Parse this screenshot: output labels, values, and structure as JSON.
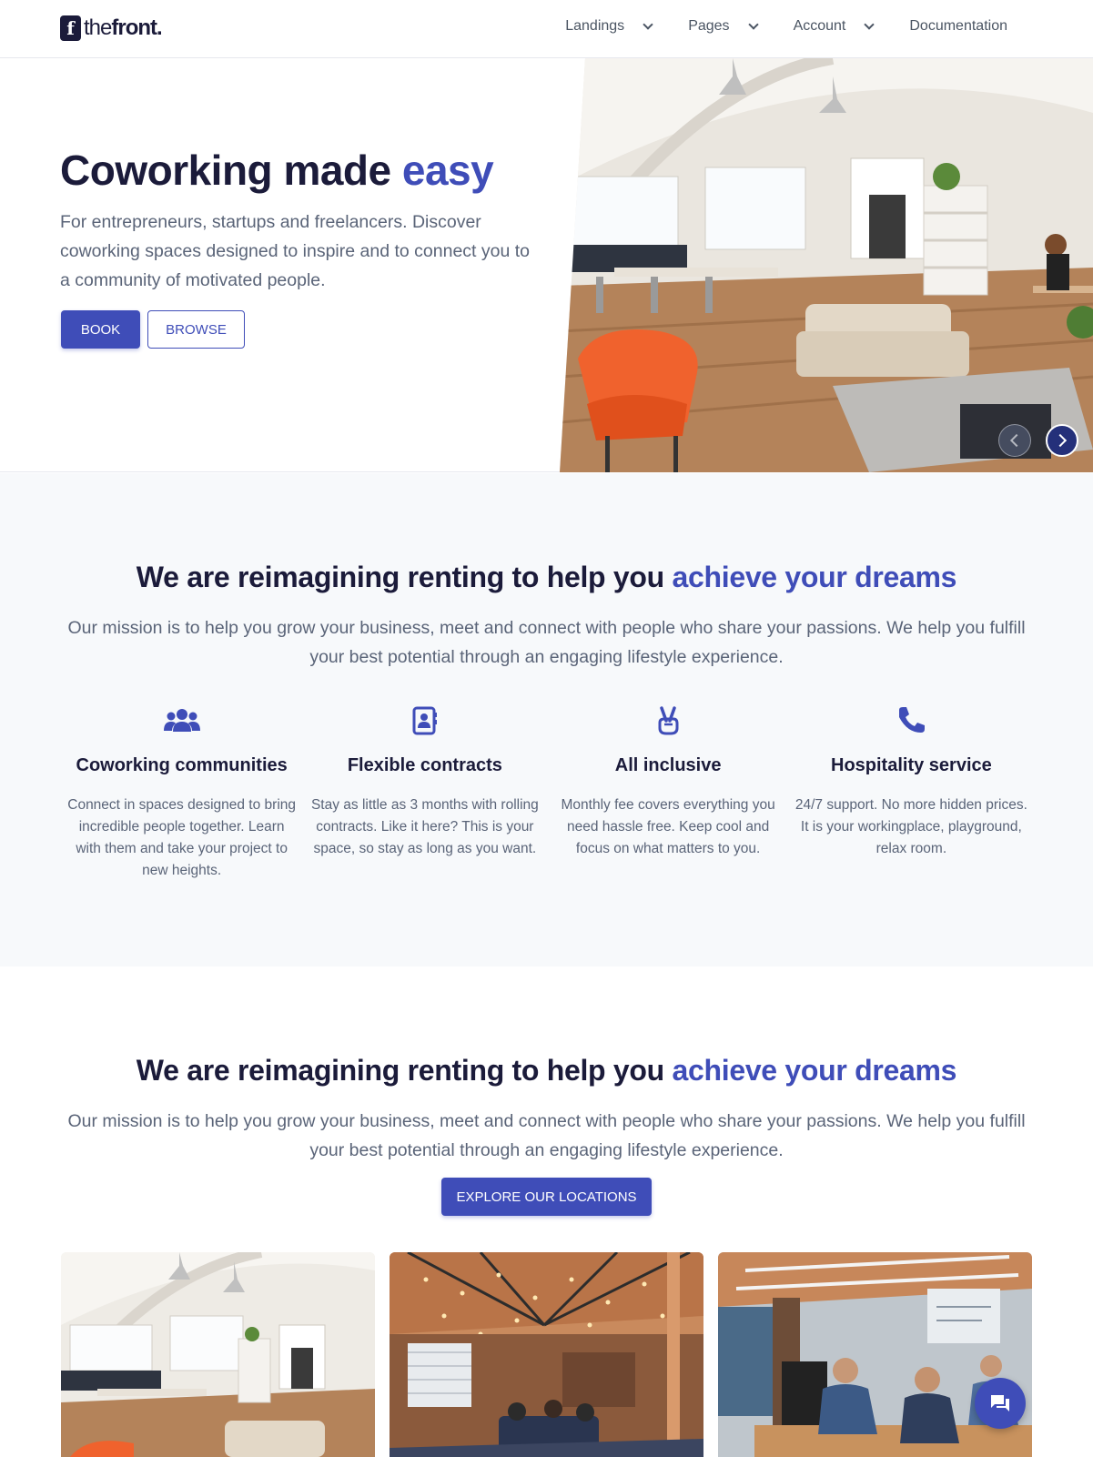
{
  "brand": {
    "mark": "f",
    "name_light": "the",
    "name_bold": "front."
  },
  "nav": {
    "items": [
      {
        "label": "Landings",
        "dropdown": true
      },
      {
        "label": "Pages",
        "dropdown": true
      },
      {
        "label": "Account",
        "dropdown": true
      },
      {
        "label": "Documentation",
        "dropdown": false
      }
    ]
  },
  "hero": {
    "title": "Coworking made",
    "title_accent": "easy",
    "subtitle": "For entrepreneurs, startups and freelancers. Discover coworking spaces designed to inspire and to connect you to a community of motivated people.",
    "primary_button": "BOOK",
    "secondary_button": "BROWSE"
  },
  "mission": {
    "title": "We are reimagining renting to help you",
    "title_accent": "achieve your dreams",
    "subtitle": "Our mission is to help you grow your business, meet and connect with people who share your passions. We help you fulfill your best potential through an engaging lifestyle experience.",
    "features": [
      {
        "icon": "users-icon",
        "title": "Coworking communities",
        "description": "Connect in spaces designed to bring incredible people together. Learn with them and take your project to new heights."
      },
      {
        "icon": "address-book-icon",
        "title": "Flexible contracts",
        "description": "Stay as little as 3 months with rolling contracts. Like it here? This is your space, so stay as long as you want."
      },
      {
        "icon": "peace-hand-icon",
        "title": "All inclusive",
        "description": "Monthly fee covers everything you need hassle free. Keep cool and focus on what matters to you."
      },
      {
        "icon": "phone-icon",
        "title": "Hospitality service",
        "description": "24/7 support. No more hidden prices. It is your workingplace, playground, relax room."
      }
    ]
  },
  "locations": {
    "title": "We are reimagining renting to help you",
    "title_accent": "achieve your dreams",
    "subtitle": "Our mission is to help you grow your business, meet and connect with people who share your passions. We help you fulfill your best potential through an engaging lifestyle experience.",
    "button": "EXPLORE OUR LOCATIONS"
  },
  "colors": {
    "accent": "#3f4db8",
    "heading": "#1b1b3a",
    "body_text": "#5a6478",
    "section_bg": "#f7f9fb"
  }
}
